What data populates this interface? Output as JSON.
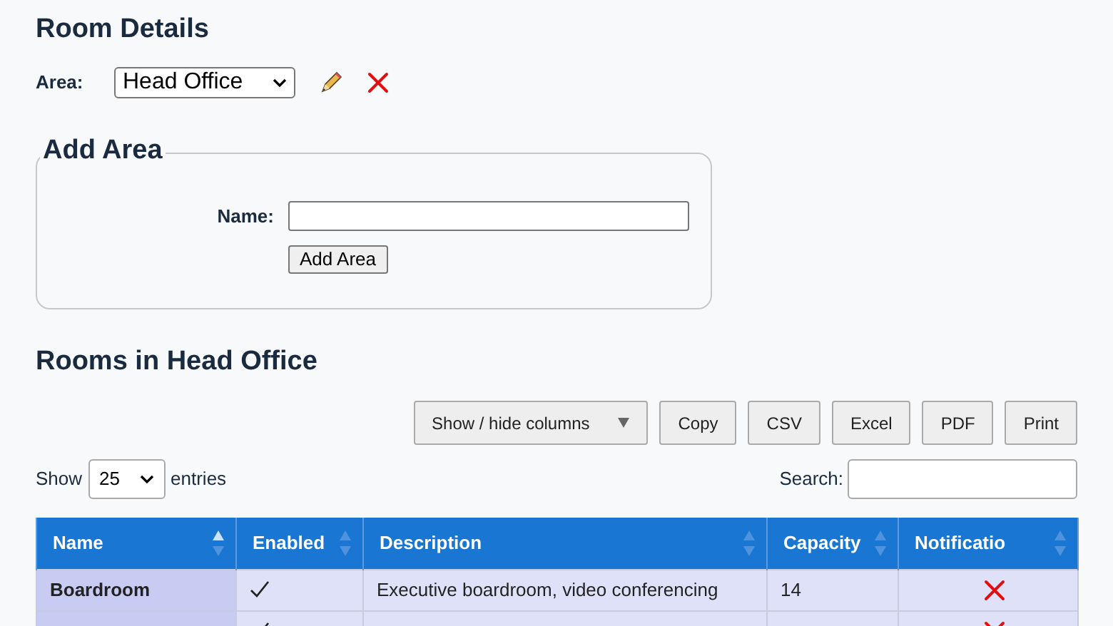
{
  "title": "Room Details",
  "area": {
    "label": "Area:",
    "value": "Head Office"
  },
  "add_area": {
    "legend": "Add Area",
    "name_label": "Name:",
    "button": "Add Area"
  },
  "rooms_heading": "Rooms in Head Office",
  "toolbar": {
    "buttons": [
      {
        "kind": "dropdown",
        "label": "Show / hide columns"
      },
      {
        "kind": "plain",
        "label": "Copy"
      },
      {
        "kind": "plain",
        "label": "CSV"
      },
      {
        "kind": "plain",
        "label": "Excel"
      },
      {
        "kind": "plain",
        "label": "PDF"
      },
      {
        "kind": "plain",
        "label": "Print"
      }
    ]
  },
  "length": {
    "before": "Show",
    "value": "25",
    "after": "entries"
  },
  "search": {
    "label": "Search:"
  },
  "table": {
    "columns": [
      {
        "label": "Name",
        "sorted": true
      },
      {
        "label": "Enabled",
        "sorted": false
      },
      {
        "label": "Description",
        "sorted": false
      },
      {
        "label": "Capacity",
        "sorted": false
      },
      {
        "label": "Notificatio",
        "sorted": false
      }
    ],
    "rows": [
      {
        "name": "Boardroom",
        "enabled": true,
        "description": "Executive boardroom, video conferencing",
        "capacity": "14",
        "notification": false
      },
      {
        "enabled": true,
        "notification": false
      }
    ]
  }
}
